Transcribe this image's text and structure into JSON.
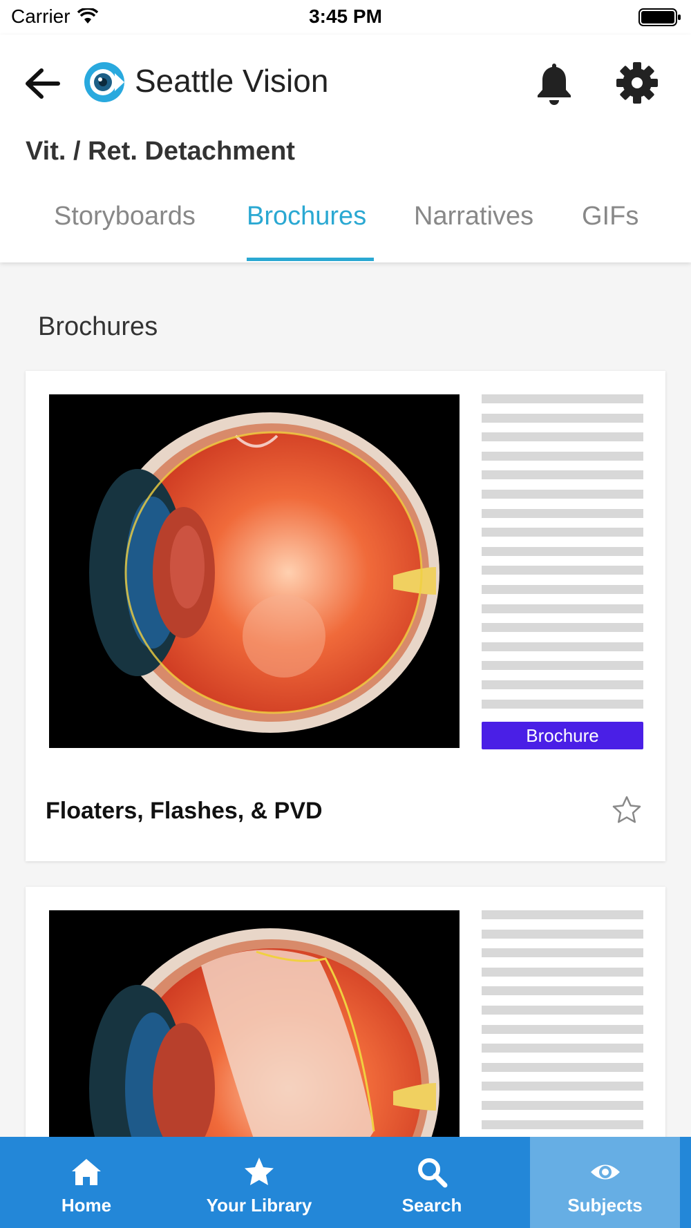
{
  "status_bar": {
    "carrier": "Carrier",
    "time": "3:45 PM"
  },
  "header": {
    "app_title": "Seattle Vision",
    "subject": "Vit. / Ret. Detachment",
    "tabs": [
      {
        "label": "Storyboards",
        "active": false
      },
      {
        "label": "Brochures",
        "active": true
      },
      {
        "label": "Narratives",
        "active": false
      },
      {
        "label": "GIFs",
        "active": false
      }
    ]
  },
  "icons": [
    "back-arrow-icon",
    "seattle-vision-logo-icon",
    "bell-icon",
    "gear-icon",
    "star-outline-icon",
    "home-icon",
    "star-icon",
    "search-icon",
    "eye-icon"
  ],
  "main": {
    "section_title": "Brochures",
    "cards": [
      {
        "title": "Floaters, Flashes, & PVD",
        "badge": "Brochure",
        "image": "eye cross-section illustration"
      },
      {
        "title": "",
        "badge": "",
        "image": "eye cross-section with retinal detachment"
      }
    ]
  },
  "bottom_nav": [
    {
      "label": "Home",
      "icon": "home-icon",
      "active": false
    },
    {
      "label": "Your Library",
      "icon": "star-icon",
      "active": false
    },
    {
      "label": "Search",
      "icon": "search-icon",
      "active": false
    },
    {
      "label": "Subjects",
      "icon": "eye-icon",
      "active": true
    }
  ],
  "colors": {
    "accent": "#2aa8d2",
    "nav_bg": "#2387d8",
    "nav_active": "#66aee4",
    "badge": "#4a1fe6"
  }
}
